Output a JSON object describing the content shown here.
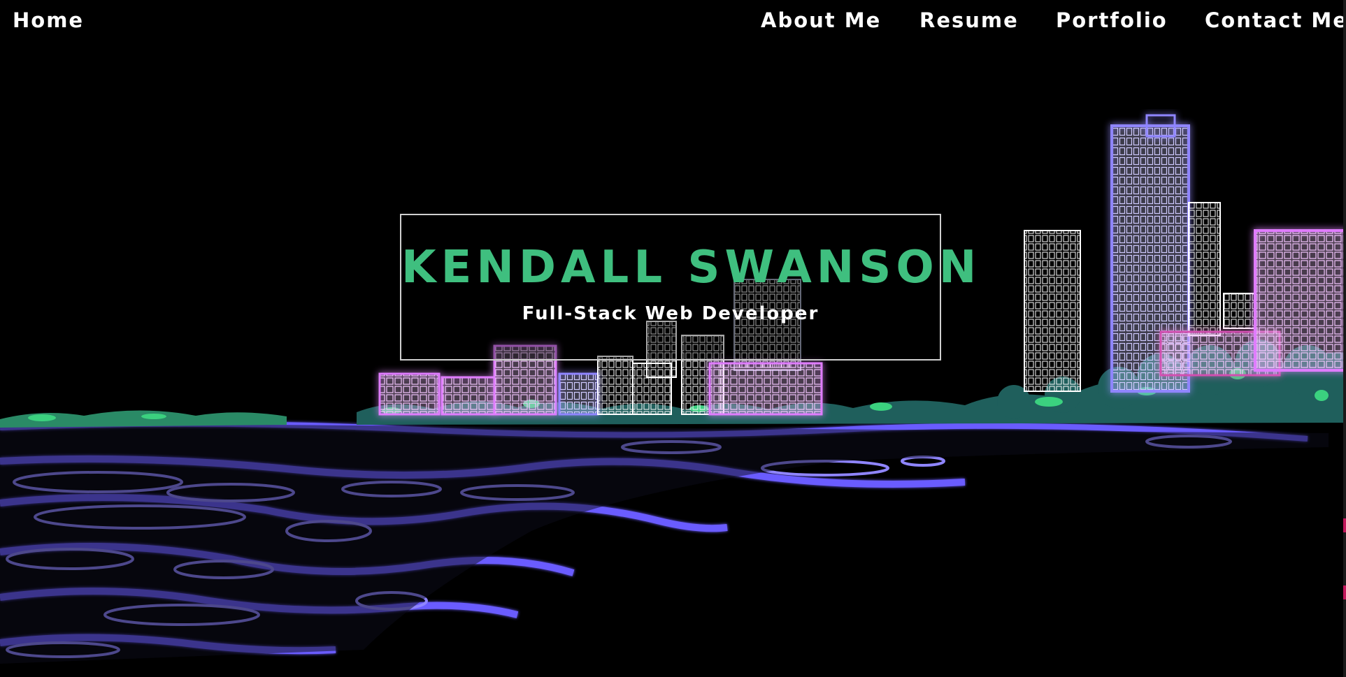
{
  "nav": {
    "home": "Home",
    "about": "About Me",
    "resume": "Resume",
    "portfolio": "Portfolio",
    "contact": "Contact Me"
  },
  "hero": {
    "name": "KENDALL SWANSON",
    "subtitle": "Full-Stack Web Developer"
  },
  "colors": {
    "accent_green": "#3fbf7f",
    "neon_purple": "#6a5cff",
    "neon_pink": "#e07bff",
    "tree_teal": "#1f5f5c",
    "background": "#000000"
  }
}
